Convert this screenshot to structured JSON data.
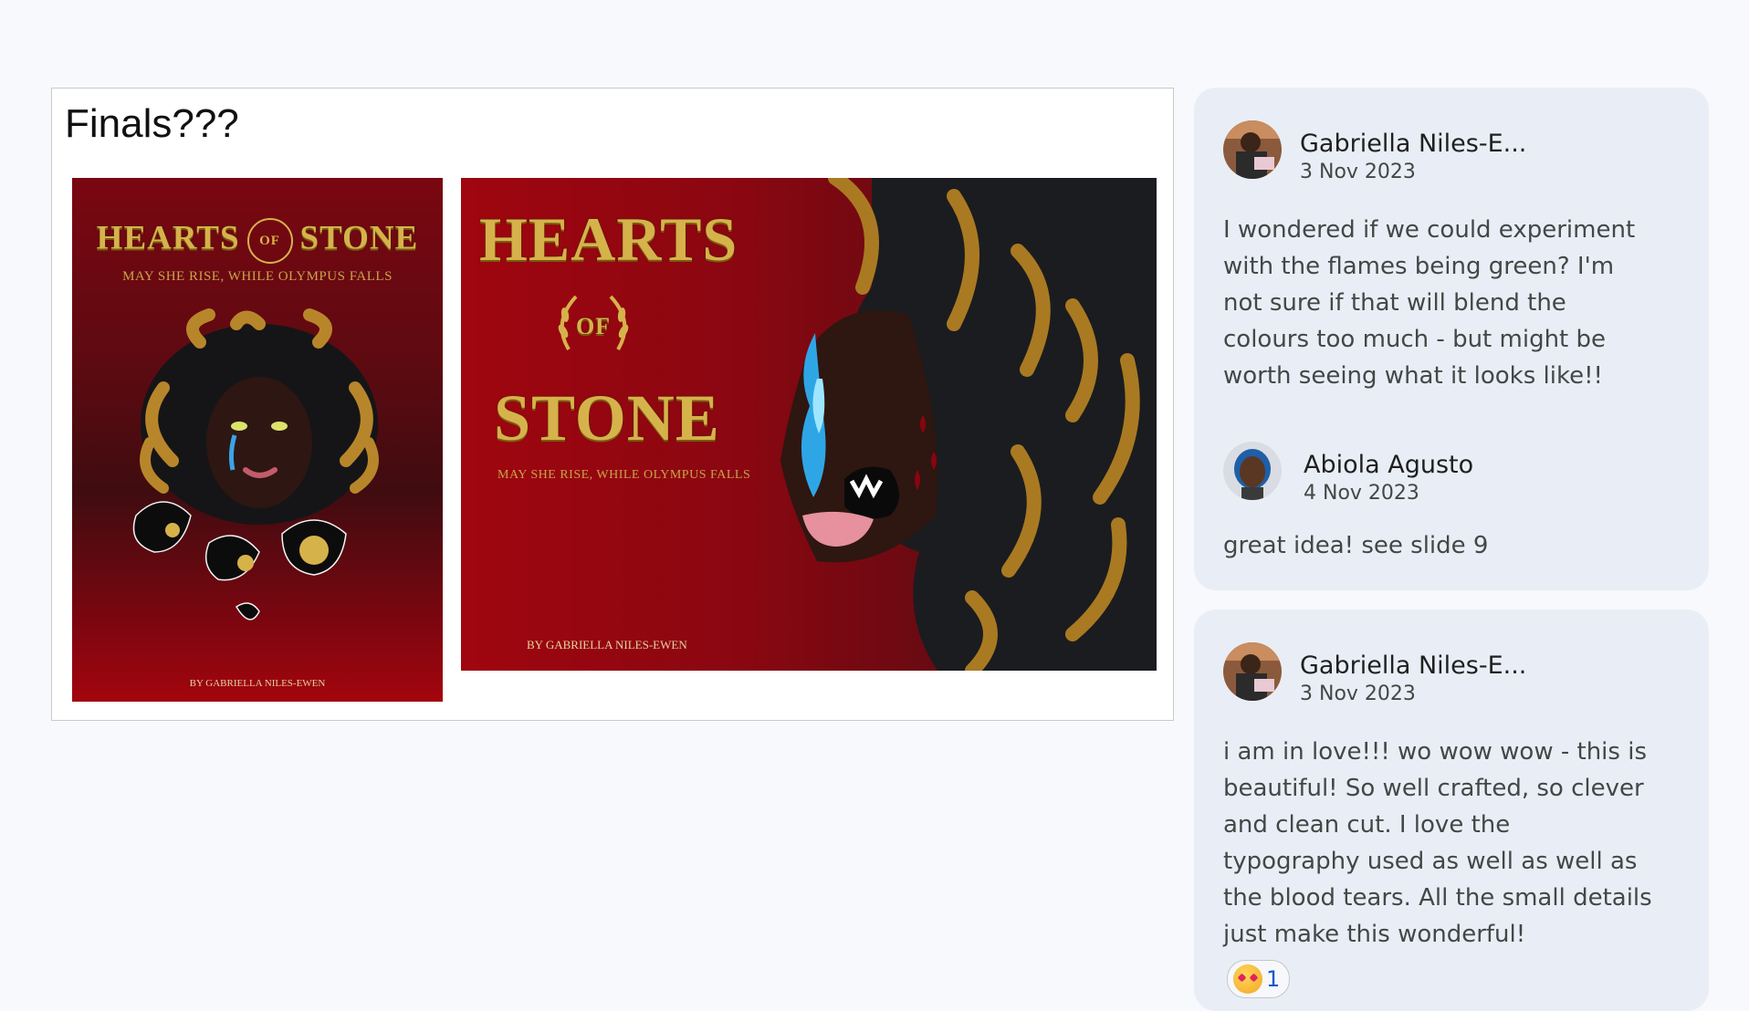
{
  "slide": {
    "title": "Finals???",
    "cover_portrait": {
      "title_left": "HEARTS",
      "title_of": "OF",
      "title_right": "STONE",
      "subtitle": "MAY SHE RISE, WHILE OLYMPUS FALLS",
      "byline": "BY GABRIELLA NILES-EWEN"
    },
    "cover_landscape": {
      "title_top": "HEARTS",
      "title_of": "OF",
      "title_bottom": "STONE",
      "subtitle": "MAY SHE RISE, WHILE OLYMPUS FALLS",
      "byline": "BY GABRIELLA NILES-EWEN"
    }
  },
  "comments": {
    "thread1": {
      "first": {
        "author": "Gabriella Niles-E...",
        "date": "3 Nov 2023",
        "text": "I wondered if we could experiment with the flames being green? I'm not sure if that will blend the colours too much - but might be worth seeing what it looks like!!"
      },
      "reply": {
        "author": "Abiola Agusto",
        "date": "4 Nov 2023",
        "text": "great idea! see slide 9"
      }
    },
    "thread2": {
      "first": {
        "author": "Gabriella Niles-E...",
        "date": "3 Nov 2023",
        "text": "i am in love!!! wo wow wow - this is beautiful! So well crafted, so clever and clean cut. I love the typography used as well as well as the blood tears. All the small details just make this wonderful!",
        "reaction_emoji": "smiling-face-with-hearts",
        "reaction_count": "1"
      }
    }
  },
  "colors": {
    "page_bg": "#f8f9fc",
    "card_bg": "#e9eef6",
    "cover_red": "#8a0711",
    "gold": "#d6b24b",
    "reaction_count": "#0b57d0"
  }
}
